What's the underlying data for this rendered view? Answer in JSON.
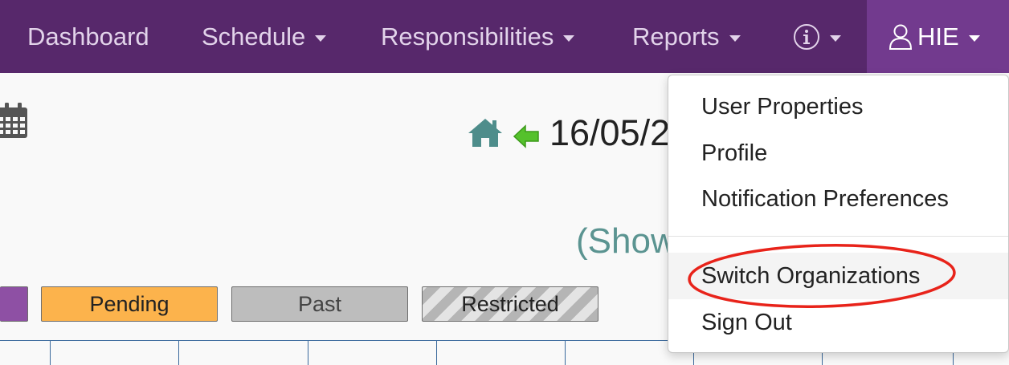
{
  "nav": {
    "items": [
      {
        "label": "Dashboard"
      },
      {
        "label": "Schedule"
      },
      {
        "label": "Responsibilities"
      },
      {
        "label": "Reports"
      }
    ],
    "info_icon": "info-icon",
    "user": {
      "label": "HIE",
      "icon": "user-icon"
    }
  },
  "main": {
    "date": "16/05/2",
    "show_link": "(Show",
    "legend": {
      "pending": "Pending",
      "past": "Past",
      "restricted": "Restricted"
    }
  },
  "user_menu": {
    "items": [
      {
        "label": "User Properties"
      },
      {
        "label": "Profile"
      },
      {
        "label": "Notification Preferences"
      },
      {
        "label": "Switch Organizations"
      },
      {
        "label": "Sign Out"
      }
    ]
  },
  "colors": {
    "navbar": "#57286b",
    "navbar_active": "#723a8e",
    "pending": "#fcb34c",
    "past": "#bdbdbd",
    "teal": "#5b9491",
    "highlight_ring": "#e8231a"
  }
}
